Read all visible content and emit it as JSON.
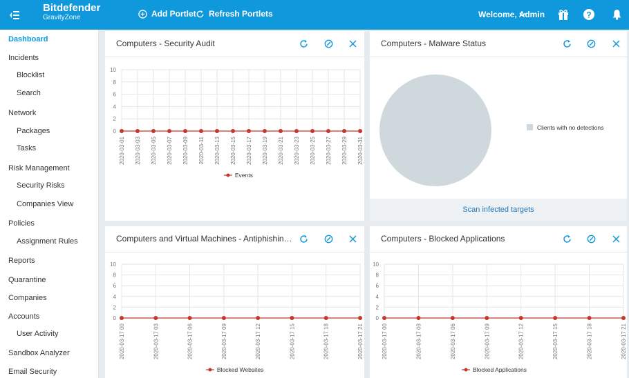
{
  "topbar": {
    "brand": "Bitdefender",
    "product": "GravityZone",
    "add_portlet": "Add Portlet",
    "refresh_portlets": "Refresh Portlets",
    "welcome": "Welcome, Admin",
    "color": "#1098dc"
  },
  "sidebar": {
    "items": [
      {
        "label": "Dashboard",
        "level": 1,
        "active": true
      },
      {
        "label": "Incidents",
        "level": 1
      },
      {
        "label": "Blocklist",
        "level": 2
      },
      {
        "label": "Search",
        "level": 2
      },
      {
        "label": "Network",
        "level": 1
      },
      {
        "label": "Packages",
        "level": 2
      },
      {
        "label": "Tasks",
        "level": 2
      },
      {
        "label": "Risk Management",
        "level": 1
      },
      {
        "label": "Security Risks",
        "level": 2
      },
      {
        "label": "Companies View",
        "level": 2
      },
      {
        "label": "Policies",
        "level": 1
      },
      {
        "label": "Assignment Rules",
        "level": 2
      },
      {
        "label": "Reports",
        "level": 1
      },
      {
        "label": "Quarantine",
        "level": 1
      },
      {
        "label": "Companies",
        "level": 1
      },
      {
        "label": "Accounts",
        "level": 1
      },
      {
        "label": "User Activity",
        "level": 2
      },
      {
        "label": "Sandbox Analyzer",
        "level": 1
      },
      {
        "label": "Email Security",
        "level": 1
      }
    ]
  },
  "portlets": {
    "p1": {
      "title": "Computers - Security Audit"
    },
    "p2": {
      "title": "Computers - Malware Status",
      "action": "Scan infected targets"
    },
    "p3": {
      "title": "Computers and Virtual Machines - Antiphishing Act..."
    },
    "p4": {
      "title": "Computers - Blocked Applications"
    }
  },
  "chart_data": [
    {
      "type": "line",
      "x": [
        "2020-03-01",
        "2020-03-02",
        "2020-03-03",
        "2020-03-04",
        "2020-03-05",
        "2020-03-06",
        "2020-03-07",
        "2020-03-08",
        "2020-03-09",
        "2020-03-10",
        "2020-03-11",
        "2020-03-12",
        "2020-03-13",
        "2020-03-14",
        "2020-03-15",
        "2020-03-16",
        "2020-03-17",
        "2020-03-18",
        "2020-03-19",
        "2020-03-20",
        "2020-03-21",
        "2020-03-22",
        "2020-03-23",
        "2020-03-24",
        "2020-03-25",
        "2020-03-26",
        "2020-03-27",
        "2020-03-28",
        "2020-03-29",
        "2020-03-30",
        "2020-03-31"
      ],
      "tick_labels": [
        "2020-03-01",
        "2020-03-03",
        "2020-03-05",
        "2020-03-07",
        "2020-03-09",
        "2020-03-11",
        "2020-03-13",
        "2020-03-15",
        "2020-03-17",
        "2020-03-19",
        "2020-03-21",
        "2020-03-23",
        "2020-03-25",
        "2020-03-27",
        "2020-03-29",
        "2020-03-31"
      ],
      "series": [
        {
          "name": "Events",
          "values": [
            0,
            0,
            0,
            0,
            0,
            0,
            0,
            0,
            0,
            0,
            0,
            0,
            0,
            0,
            0,
            0,
            0,
            0,
            0,
            0,
            0,
            0,
            0,
            0,
            0,
            0,
            0,
            0,
            0,
            0,
            0
          ],
          "color": "#c0392b"
        }
      ],
      "yticks": [
        0,
        2,
        4,
        6,
        8,
        10
      ],
      "ylim": [
        0,
        10
      ],
      "grid": true,
      "legend": "bottom"
    },
    {
      "type": "pie",
      "categories": [
        "Clients with no detections"
      ],
      "values": [
        100
      ],
      "colors": [
        "#cfd8dd"
      ],
      "legend": "right"
    },
    {
      "type": "line",
      "x": [
        "2020-03-17 00",
        "2020-03-17 03",
        "2020-03-17 06",
        "2020-03-17 09",
        "2020-03-17 12",
        "2020-03-17 15",
        "2020-03-17 18",
        "2020-03-17 21"
      ],
      "series": [
        {
          "name": "Blocked Websites",
          "values": [
            0,
            0,
            0,
            0,
            0,
            0,
            0,
            0
          ],
          "color": "#c0392b"
        }
      ],
      "yticks": [
        0,
        2,
        4,
        6,
        8,
        10
      ],
      "ylim": [
        0,
        10
      ],
      "grid": true,
      "legend": "bottom"
    },
    {
      "type": "line",
      "x": [
        "2020-03-17 00",
        "2020-03-17 03",
        "2020-03-17 06",
        "2020-03-17 09",
        "2020-03-17 12",
        "2020-03-17 15",
        "2020-03-17 18",
        "2020-03-17 21"
      ],
      "series": [
        {
          "name": "Blocked Applications",
          "values": [
            0,
            0,
            0,
            0,
            0,
            0,
            0,
            0
          ],
          "color": "#c0392b"
        }
      ],
      "yticks": [
        0,
        2,
        4,
        6,
        8,
        10
      ],
      "ylim": [
        0,
        10
      ],
      "grid": true,
      "legend": "bottom"
    }
  ]
}
